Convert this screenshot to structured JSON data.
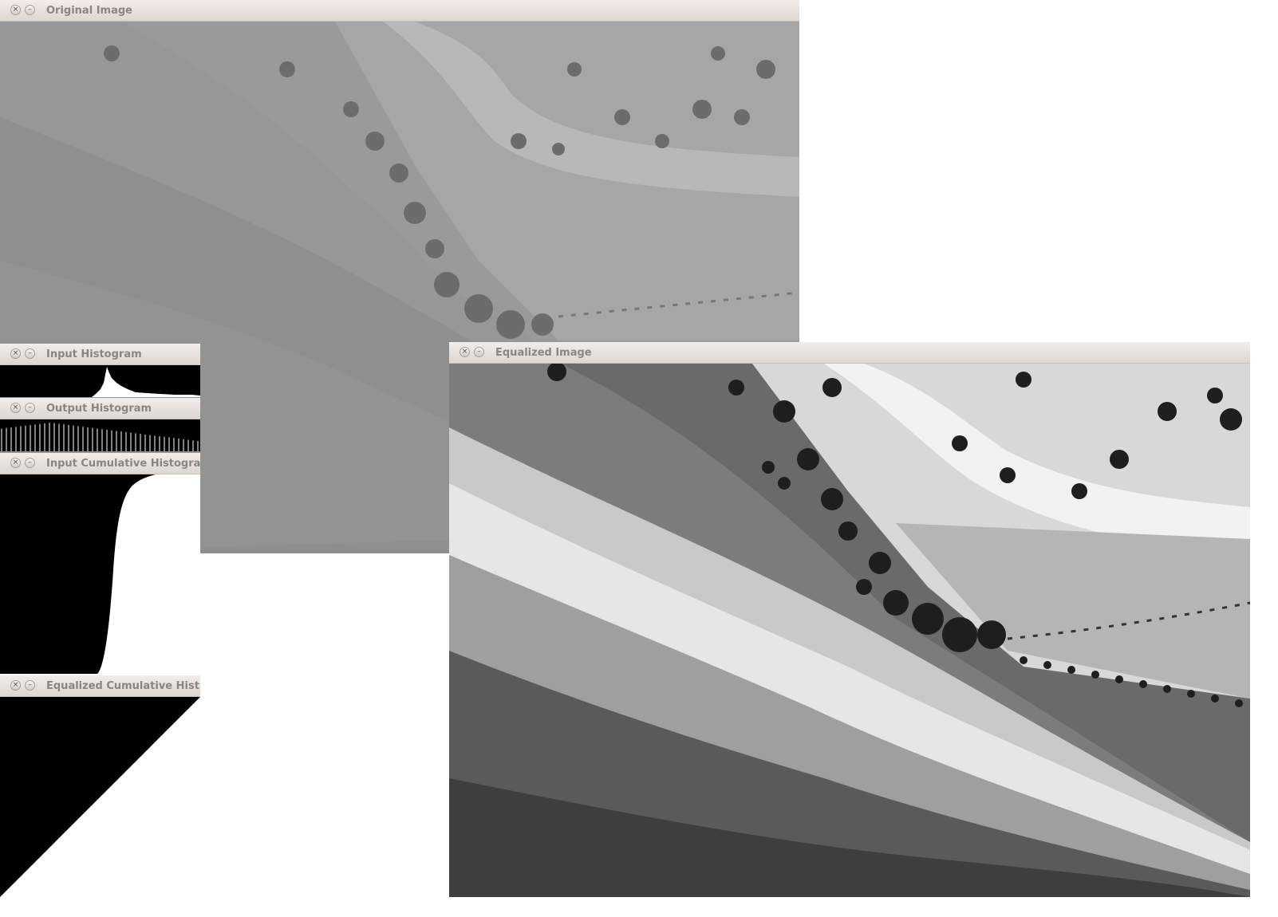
{
  "windows": {
    "original": {
      "title": "Original Image",
      "close_glyph": "×",
      "min_glyph": "–"
    },
    "input_hist": {
      "title": "Input Histogram",
      "close_glyph": "×",
      "min_glyph": "–"
    },
    "output_hist": {
      "title": "Output Histogram",
      "close_glyph": "×",
      "min_glyph": "–"
    },
    "input_cum": {
      "title": "Input Cumulative Histogra",
      "close_glyph": "×",
      "min_glyph": "–"
    },
    "eq_cum": {
      "title": "Equalized Cumulative Hist",
      "close_glyph": "×",
      "min_glyph": "–"
    },
    "equalized": {
      "title": "Equalized Image",
      "close_glyph": "×",
      "min_glyph": "–"
    }
  },
  "icons": {
    "close": "close-icon",
    "minimize": "minimize-icon"
  },
  "colors": {
    "titlebar_top": "#f1ede9",
    "titlebar_bottom": "#ddd7d1",
    "title_text": "#8a8580",
    "histogram_bg": "#000000",
    "histogram_fg": "#ffffff"
  }
}
